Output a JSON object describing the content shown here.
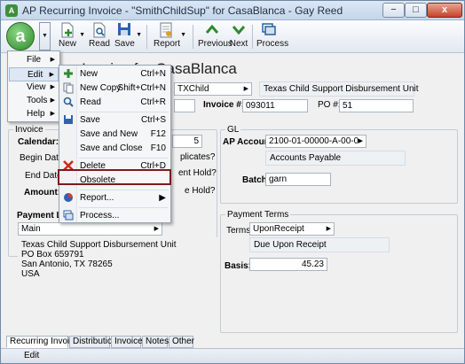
{
  "window": {
    "title": "AP Recurring Invoice - \"SmithChildSup\" for CasaBlanca - Gay Reed",
    "app_icon": "A",
    "min": "−",
    "max": "□",
    "close": "x"
  },
  "toolbar": {
    "app_button": "a",
    "new": "New",
    "read": "Read",
    "save": "Save",
    "report": "Report",
    "previous": "Previous",
    "next": "Next",
    "process": "Process"
  },
  "form": {
    "heading": "ring Invoice for CasaBlanca",
    "vendor_code": "TXChild",
    "vendor_name": "Texas Child Support Disbursement Unit",
    "invoice_label": "Invoice #:",
    "invoice_value": "093011",
    "po_label": "PO #:",
    "po_value": "51",
    "invoice_group": "Invoice",
    "calendar_label": "Calendar:",
    "calendar_value": "5",
    "begin_date_label": "Begin Date:",
    "end_date_label": "End Date:",
    "amount_label": "Amount:",
    "duplicates_text": "plicates?",
    "payment_hold_text": "ent Hold?",
    "e_hold_text": "e Hold?",
    "gl_group": "GL",
    "ap_account_label": "AP Account:",
    "ap_account_value": "2100-01-00000-A-00-0",
    "ap_account_desc": "Accounts Payable",
    "batch_label": "Batch:",
    "batch_value": "garn",
    "payment_loc_label": "Payment Lo",
    "payment_loc_value": "Main",
    "address": [
      "Texas Child Support Disbursement Unit",
      "PO Box 659791",
      "San Antonio, TX 78265",
      "USA"
    ],
    "payment_terms_group": "Payment Terms",
    "terms_label": "Terms:",
    "terms_value": "UponReceipt",
    "terms_desc": "Due Upon Receipt",
    "basis_label": "Basis:",
    "basis_value": "45.23"
  },
  "menu": {
    "file": "File",
    "edit": "Edit",
    "view": "View",
    "tools": "Tools",
    "help": "Help"
  },
  "submenu": {
    "new": "New",
    "new_sc": "Ctrl+N",
    "new_copy": "New Copy",
    "new_copy_sc": "Shift+Ctrl+N",
    "read": "Read",
    "read_sc": "Ctrl+R",
    "save": "Save",
    "save_sc": "Ctrl+S",
    "save_new": "Save and New",
    "save_new_sc": "F12",
    "save_close": "Save and Close",
    "save_close_sc": "F10",
    "delete": "Delete",
    "delete_sc": "Ctrl+D",
    "obsolete": "Obsolete",
    "report": "Report...",
    "process": "Process..."
  },
  "tabs": [
    "Recurring Invoices",
    "Distribution",
    "Invoices",
    "Notes",
    "Other"
  ],
  "status": {
    "text": "Edit"
  }
}
